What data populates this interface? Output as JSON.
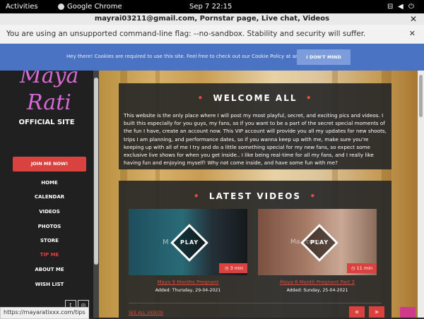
{
  "system_bar": {
    "activities": "Activities",
    "app": "Google Chrome",
    "clock": "Sep 7  22:15"
  },
  "window": {
    "title": "mayrai03211@gmail.com, Pornstar page, Live chat, Videos"
  },
  "infobar": {
    "message": "You are using an unsupported command-line flag: --no-sandbox. Stability and security will suffer."
  },
  "cookie": {
    "text": "Hey there! Cookies are required to use this site. Feel free to check out our Cookie Policy at any time.",
    "button": "I DON'T MIND COOKIES"
  },
  "sidebar": {
    "logo_line1": "Maya",
    "logo_line2": "Rati",
    "official": "OFFICIAL SITE",
    "join": "JOIN ME NOW!",
    "nav": [
      "HOME",
      "CALENDAR",
      "VIDEOS",
      "PHOTOS",
      "STORE",
      "TIP ME",
      "ABOUT ME",
      "WISH LIST"
    ]
  },
  "welcome": {
    "title": "WELCOME ALL",
    "body": "This website is the only place where I will post my most playful, secret, and exciting pics and videos. I built this especially for you guys, my fans, so if you want to be a part of the secret special moments of the fun I have, create an account now. This VIP account will provide you all my updates for new shoots, trips I am planning, and performance dates, so if you wanna keep up with me, make sure you're keeping up with all of me I try and do a little something special for my new fans, so expect some exclusive live shows for when you get inside.. I like being real-time for all my fans, and I really like having fun and enjoying myself! Why not come inside, and have some fun with me?"
  },
  "videos": {
    "title": "LATEST VIDEOS",
    "play_label": "PLAY",
    "items": [
      {
        "title": "Maya 9 Months Pregnant",
        "added": "Added: Thursday, 29-04-2021",
        "duration": "3 min",
        "watermark": "M"
      },
      {
        "title": "Maya 6 Month Pregnant Part 2",
        "added": "Added: Sunday, 25-04-2021",
        "duration": "11 min",
        "watermark": "Ma...com"
      }
    ],
    "see_all": "SEE ALL VIDEOS",
    "prev": "«",
    "next": "»"
  },
  "status_url": "https://mayaratixxx.com/tips",
  "colors": {
    "accent": "#d9423e",
    "cookie_bar": "#4b73c4",
    "logo": "#d868d8"
  }
}
